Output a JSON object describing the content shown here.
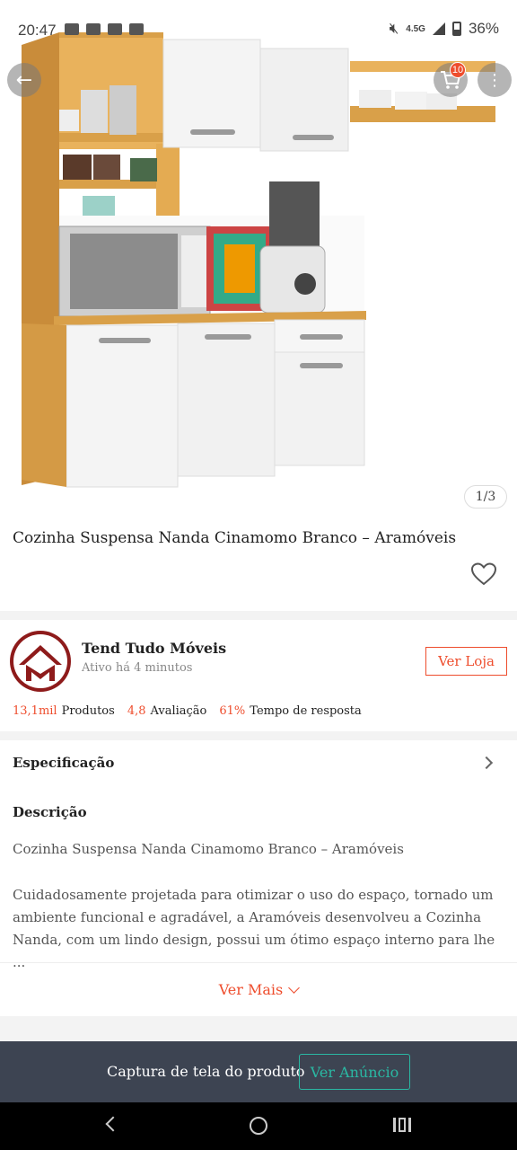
{
  "status_bar": {
    "time": "20:47",
    "network": "4.5G",
    "battery": "36%"
  },
  "gallery": {
    "counter": "1/3",
    "cart_count": "10"
  },
  "product": {
    "title": "Cozinha Suspensa Nanda Cinamomo Branco – Aramóveis"
  },
  "shop": {
    "name": "Tend Tudo Móveis",
    "active": "Ativo há 4 minutos",
    "view_store_label": "Ver Loja",
    "stats": [
      {
        "value": "13,1mil",
        "label": "Produtos"
      },
      {
        "value": "4,8",
        "label": "Avaliação"
      },
      {
        "value": "61%",
        "label": "Tempo de resposta"
      }
    ]
  },
  "specification": {
    "label": "Especificação"
  },
  "description": {
    "heading": "Descrição",
    "first_line": "Cozinha Suspensa Nanda Cinamomo Branco – Aramóveis",
    "body": "Cuidadosamente projetada para otimizar o uso do espaço, tornado um ambiente funcional e agradável, a Aramóveis desenvolveu a Cozinha Nanda, com um lindo design, possui um ótimo espaço interno para lhe ..."
  },
  "ver_mais_label": "Ver Mais",
  "capture_bar": {
    "text": "Captura de tela do produto",
    "button_label": "Ver Anúncio"
  },
  "colors": {
    "accent": "#ee4d2d",
    "teal": "#2ab8a3",
    "bar_bg": "#3d4452",
    "wood": "#d9a049",
    "cabinet_white": "#f4f4f4"
  }
}
